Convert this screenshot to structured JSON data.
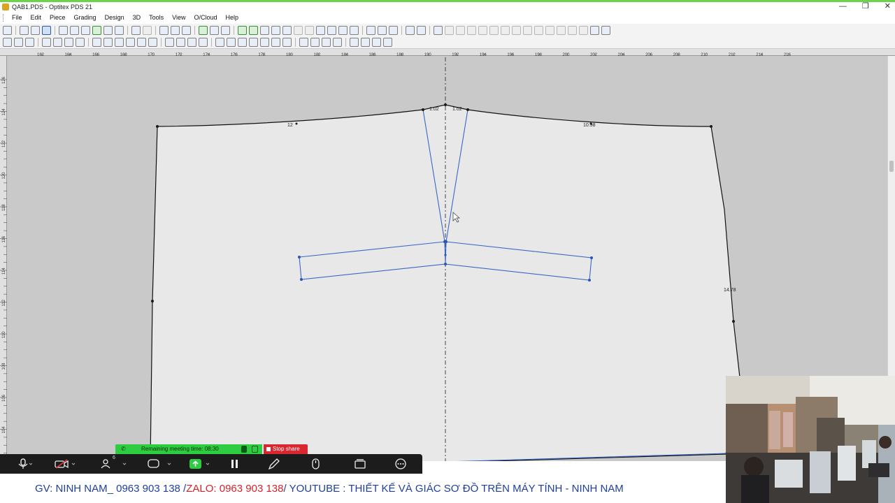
{
  "window": {
    "title": "QAB1.PDS - Optitex PDS 21",
    "buttons": [
      "—",
      "❐",
      "✕"
    ]
  },
  "menu": [
    "File",
    "Edit",
    "Piece",
    "Grading",
    "Design",
    "3D",
    "Tools",
    "View",
    "O/Cloud",
    "Help"
  ],
  "ruler": {
    "horizontal_labels": [
      "162",
      "164",
      "166",
      "168",
      "170",
      "172",
      "174",
      "176",
      "178",
      "180",
      "182",
      "184",
      "186",
      "188",
      "190",
      "192",
      "194",
      "196",
      "198",
      "200",
      "202",
      "204",
      "206",
      "208",
      "210",
      "212",
      "214",
      "216"
    ],
    "vertical_labels": [
      "126",
      "124",
      "122",
      "120",
      "118",
      "116",
      "114",
      "112",
      "110",
      "108",
      "106",
      "104"
    ]
  },
  "pattern": {
    "labels": {
      "left_waist": "12",
      "dart_left": "1.02",
      "dart_right": "1.02",
      "right_waist": "10.98",
      "right_side": "14.78"
    }
  },
  "meeting": {
    "remaining": "Remaining meeting time: 08:30",
    "stop_share": "Stop share",
    "participants_count": "6"
  },
  "banner": {
    "part1": "GV: NINH NAM_ 0963 903 138 / ",
    "part2": "ZALO: 0963 903 138",
    "part3": " / YOUTUBE : THIẾT KẾ VÀ GIÁC SƠ ĐỒ TRÊN MÁY TÍNH - NINH NAM"
  },
  "colors": {
    "outline": "#111111",
    "internal_blue": "#3a67c7",
    "canvas_bg": "#c9c9c9",
    "piece_fill": "#e8e8e8",
    "remain_green": "#2ecc40",
    "stop_red": "#d9262f",
    "banner_blue": "#1f3f9a",
    "banner_red": "#d8222b"
  }
}
